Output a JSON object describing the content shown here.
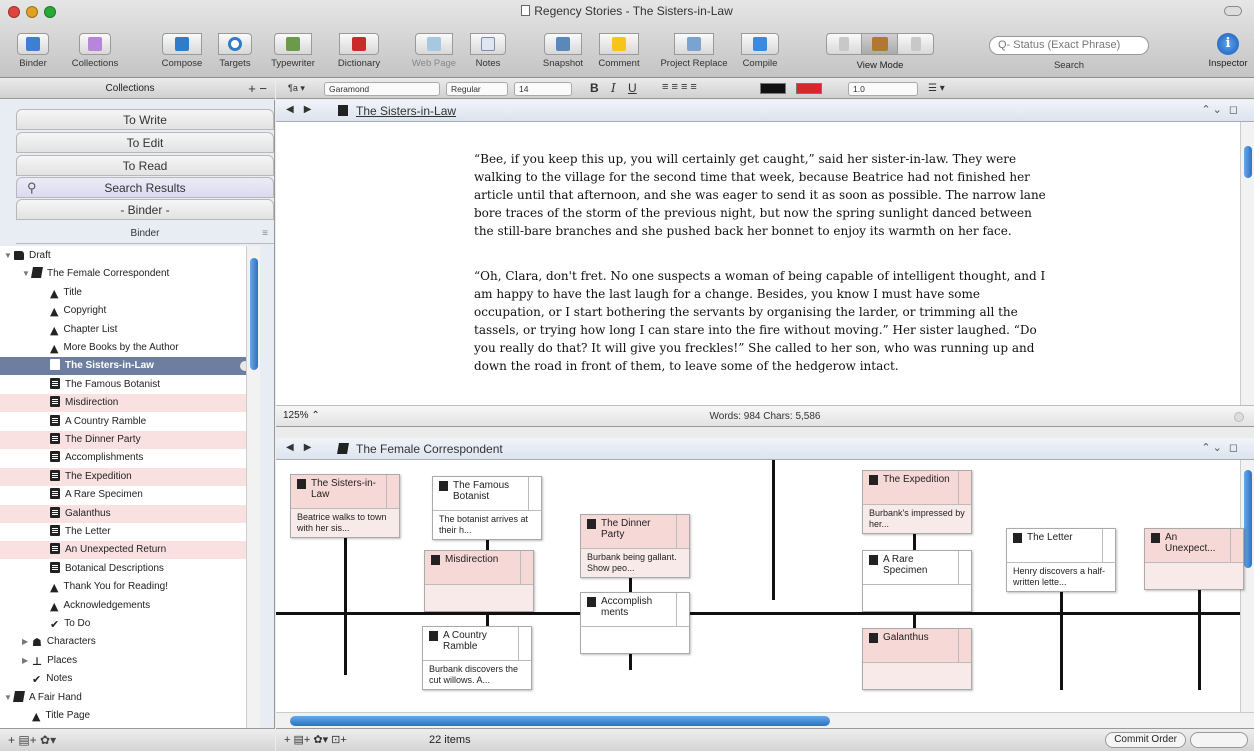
{
  "window": {
    "title": "Regency Stories - The Sisters-in-Law"
  },
  "toolbar": {
    "binder": "Binder",
    "collections": "Collections",
    "compose": "Compose",
    "targets": "Targets",
    "typewriter": "Typewriter",
    "dictionary": "Dictionary",
    "web_page": "Web Page",
    "notes": "Notes",
    "snapshot": "Snapshot",
    "comment": "Comment",
    "project_replace": "Project Replace",
    "compile": "Compile",
    "view_mode": "View Mode",
    "search_placeholder": "Q- Status (Exact Phrase)",
    "search_label": "Search",
    "inspector": "Inspector"
  },
  "collections_header": {
    "label": "Collections",
    "controls": "+ −"
  },
  "format_bar": {
    "style_menu": "¶a ▾",
    "font": "Garamond",
    "weight": "Regular",
    "size": "14",
    "bold": "B",
    "italic": "I",
    "underline": "U",
    "align": "≡ ≡ ≡ ≡",
    "line_spacing": "1.0",
    "list": "☰ ▾",
    "text_color": "#111111",
    "highlight_color": "#d9262b"
  },
  "sidebar": {
    "collection_tabs": [
      "To Write",
      "To Edit",
      "To Read",
      "Search Results",
      "- Binder -"
    ],
    "binder_label": "Binder",
    "items": [
      {
        "label": "Draft",
        "icon": "folder-icon",
        "indent": 0,
        "disclosure": "▼",
        "state": ""
      },
      {
        "label": "The Female Correspondent",
        "icon": "stack-icon",
        "indent": 1,
        "disclosure": "▼",
        "state": ""
      },
      {
        "label": "Title",
        "icon": "title-icon",
        "indent": 2,
        "disclosure": "",
        "state": ""
      },
      {
        "label": "Copyright",
        "icon": "title-icon",
        "indent": 2,
        "disclosure": "",
        "state": ""
      },
      {
        "label": "Chapter List",
        "icon": "title-icon",
        "indent": 2,
        "disclosure": "",
        "state": ""
      },
      {
        "label": "More Books by the Author",
        "icon": "title-icon",
        "indent": 2,
        "disclosure": "",
        "state": ""
      },
      {
        "label": "The Sisters-in-Law",
        "icon": "document-icon",
        "indent": 2,
        "disclosure": "",
        "state": "selected"
      },
      {
        "label": "The Famous Botanist",
        "icon": "document-icon",
        "indent": 2,
        "disclosure": "",
        "state": ""
      },
      {
        "label": "Misdirection",
        "icon": "document-icon",
        "indent": 2,
        "disclosure": "",
        "state": "pink"
      },
      {
        "label": "A Country Ramble",
        "icon": "document-icon",
        "indent": 2,
        "disclosure": "",
        "state": ""
      },
      {
        "label": "The Dinner Party",
        "icon": "document-icon",
        "indent": 2,
        "disclosure": "",
        "state": "pink"
      },
      {
        "label": "Accomplishments",
        "icon": "document-icon",
        "indent": 2,
        "disclosure": "",
        "state": ""
      },
      {
        "label": "The Expedition",
        "icon": "document-icon",
        "indent": 2,
        "disclosure": "",
        "state": "pink"
      },
      {
        "label": "A Rare Specimen",
        "icon": "document-icon",
        "indent": 2,
        "disclosure": "",
        "state": ""
      },
      {
        "label": "Galanthus",
        "icon": "document-icon",
        "indent": 2,
        "disclosure": "",
        "state": "pink"
      },
      {
        "label": "The Letter",
        "icon": "document-icon",
        "indent": 2,
        "disclosure": "",
        "state": ""
      },
      {
        "label": "An Unexpected Return",
        "icon": "document-icon",
        "indent": 2,
        "disclosure": "",
        "state": "pink"
      },
      {
        "label": "Botanical Descriptions",
        "icon": "document-icon",
        "indent": 2,
        "disclosure": "",
        "state": ""
      },
      {
        "label": "Thank You for Reading!",
        "icon": "title-icon",
        "indent": 2,
        "disclosure": "",
        "state": ""
      },
      {
        "label": "Acknowledgements",
        "icon": "title-icon",
        "indent": 2,
        "disclosure": "",
        "state": ""
      },
      {
        "label": "To Do",
        "icon": "check-icon",
        "indent": 2,
        "disclosure": "",
        "state": ""
      },
      {
        "label": "Characters",
        "icon": "characters-icon",
        "indent": 1,
        "disclosure": "▶",
        "state": ""
      },
      {
        "label": "Places",
        "icon": "pin-icon",
        "indent": 1,
        "disclosure": "▶",
        "state": ""
      },
      {
        "label": "Notes",
        "icon": "check-icon",
        "indent": 1,
        "disclosure": "",
        "state": ""
      },
      {
        "label": "A Fair Hand",
        "icon": "stack-icon",
        "indent": 0,
        "disclosure": "▼",
        "state": ""
      },
      {
        "label": "Title Page",
        "icon": "title-icon",
        "indent": 1,
        "disclosure": "",
        "state": ""
      }
    ],
    "footer": "+   ▤+   ✿▾"
  },
  "editor": {
    "header_title": "The Sisters-in-Law",
    "paragraphs": [
      "“Bee, if you keep this up, you will certainly get caught,” said her sister-in-law. They were walking to the village for the second time that week, because Beatrice had not finished her article until that afternoon, and she was eager to send it as soon as possible. The narrow lane bore traces of the storm of the previous night, but now the spring sunlight danced between the still-bare branches and she pushed back her bonnet to enjoy its warmth on her face.",
      "“Oh, Clara, don't fret. No one suspects a woman of being capable of intelligent thought, and I am happy to have the last laugh for a change. Besides, you know I must have some occupation, or I start bothering the servants by organising the larder, or trimming all the tassels, or trying how long I can stare into the fire without moving.” Her sister laughed. “Do you really do that? It will give you freckles!” She called to her son, who was running up and down the road in front of them, to leave some of the hedgerow intact."
    ],
    "zoom": "125%",
    "stats": "Words: 984   Chars: 5,586"
  },
  "timeline": {
    "header_title": "The Female Correspondent",
    "cards": [
      {
        "title": "The Sisters-in-Law",
        "synopsis": "Beatrice walks to town with her sis...",
        "pink": true
      },
      {
        "title": "The Famous Botanist",
        "synopsis": "The botanist arrives at their h...",
        "pink": false
      },
      {
        "title": "Misdirection",
        "synopsis": "",
        "pink": true
      },
      {
        "title": "A Country Ramble",
        "synopsis": "Burbank discovers the cut willows. A...",
        "pink": false
      },
      {
        "title": "The Dinner Party",
        "synopsis": "Burbank being gallant. Show peo...",
        "pink": true
      },
      {
        "title": "Accomplish ments",
        "synopsis": "",
        "pink": false
      },
      {
        "title": "The Expedition",
        "synopsis": "Burbank's impressed by her...",
        "pink": true
      },
      {
        "title": "A Rare Specimen",
        "synopsis": "",
        "pink": false
      },
      {
        "title": "Galanthus",
        "synopsis": "",
        "pink": true
      },
      {
        "title": "The Letter",
        "synopsis": "Henry discovers a half-written lette...",
        "pink": false
      },
      {
        "title": "An Unexpect...",
        "synopsis": "",
        "pink": true
      }
    ],
    "footer_tools": "+   ▤+   ✿▾   ⊡+",
    "item_count": "22 items",
    "commit_order": "Commit Order"
  }
}
